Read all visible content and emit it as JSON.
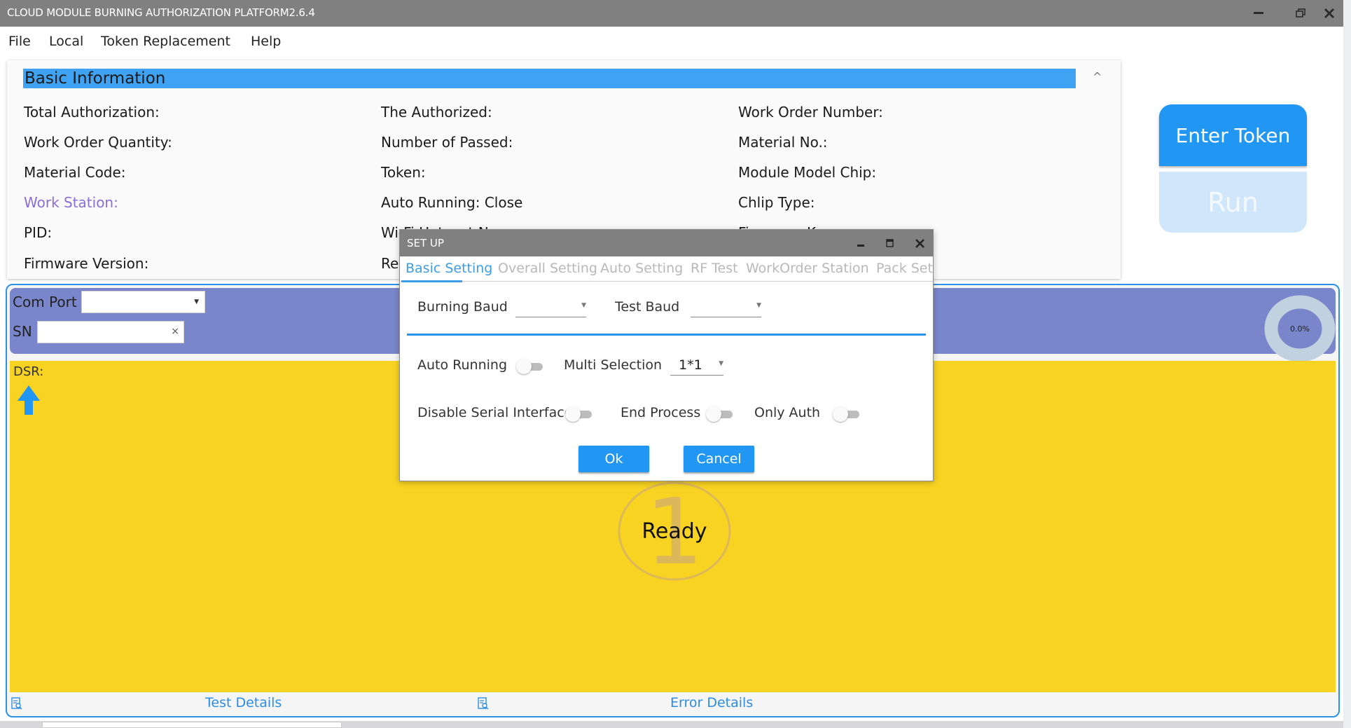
{
  "window": {
    "title": "CLOUD MODULE BURNING AUTHORIZATION PLATFORM2.6.4",
    "controls": {
      "minimize": "—",
      "restore": "❐",
      "close": "✕"
    }
  },
  "menu": [
    "File",
    "Local",
    "Token Replacement",
    "Help"
  ],
  "info_panel": {
    "header": "Basic Information",
    "collapse_icon": "^",
    "columns": [
      [
        "Total Authorization:",
        "Work Order Quantity:",
        "Material Code:",
        "Work Station:",
        "PID:",
        "Firmware Version:"
      ],
      [
        "The Authorized:",
        "Number of Passed:",
        "Token:",
        "Auto Running: Close",
        "Wi-Fi Hotspot Name:",
        "Re"
      ],
      [
        "Work Order Number:",
        "Material No.:",
        "Module Model Chip:",
        "Chlip Type:",
        "Firmware Key:"
      ]
    ],
    "highlight_color": "#8a6fd6"
  },
  "actions": {
    "enter_token": "Enter Token",
    "run": "Run"
  },
  "station": {
    "com_port_label": "Com Port",
    "com_port_value": "",
    "sn_label": "SN",
    "sn_value": "",
    "sn_clear": "×",
    "progress": 0.0,
    "progress_text": "0.0%",
    "dsr_label": "DSR:",
    "slot_number": "1",
    "status": "Ready",
    "test_details": "Test Details",
    "error_details": "Error Details"
  },
  "dialog": {
    "title": "SET UP",
    "controls": {
      "minimize": "▁",
      "maximize": "▭",
      "close": "✕"
    },
    "tabs": [
      "Basic Setting",
      "Overall Setting",
      "Auto Setting",
      "RF Test",
      "WorkOrder Station",
      "Pack Set"
    ],
    "active_tab": "Basic Setting",
    "burning_baud_label": "Burning Baud",
    "burning_baud_value": "",
    "test_baud_label": "Test Baud",
    "test_baud_value": "",
    "auto_running_label": "Auto Running",
    "auto_running": false,
    "multi_selection_label": "Multi Selection",
    "multi_selection_value": "1*1",
    "disable_serial_label": "Disable Serial Interface",
    "disable_serial": false,
    "end_process_label": "End Process",
    "end_process": false,
    "only_auth_label": "Only Auth",
    "only_auth": false,
    "ok": "Ok",
    "cancel": "Cancel"
  },
  "colors": {
    "accent": "#2196f3",
    "header_blue": "#3fa2f3",
    "station_bar": "#7986cb",
    "status_yellow": "#f8d322",
    "titlebar": "#808080"
  }
}
